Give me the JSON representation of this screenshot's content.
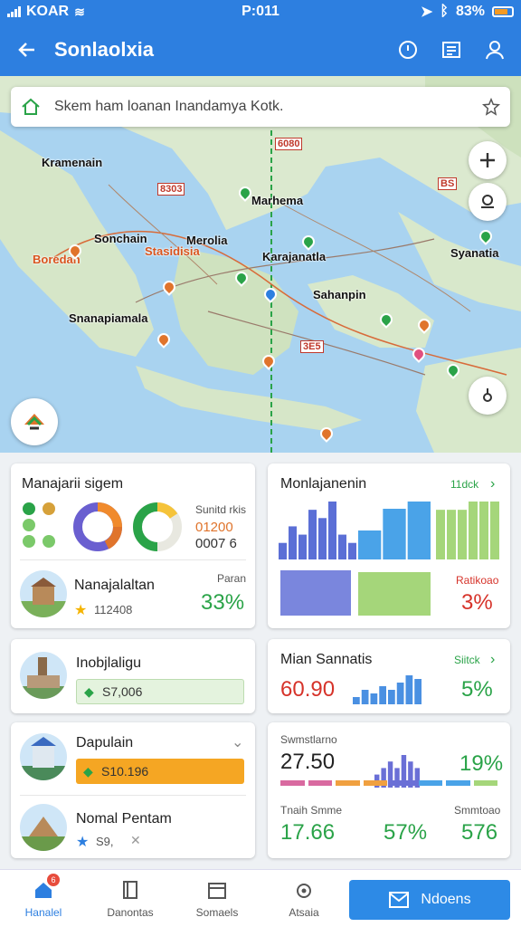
{
  "status_bar": {
    "carrier": "KOAR",
    "time": "P:011",
    "battery": "83%"
  },
  "app_bar": {
    "title": "Sonlaolxia"
  },
  "search": {
    "text": "Skem ham loanan Inandamya Kotk."
  },
  "map_labels": {
    "kramenain": "Kramenain",
    "marhema": "Marhema",
    "sonchain": "Sonchain",
    "merolia": "Merolia",
    "karajanatla": "Karajanatla",
    "boredan": "Boredan",
    "stasidisia": "Stasidisia",
    "syanatia": "Syanatia",
    "sahanpin": "Sahanpin",
    "snanapiamala": "Snanapiamala",
    "badge_a": "6080",
    "badge_b": "8303",
    "badge_c": "3E5",
    "badge_d": "BS"
  },
  "card1": {
    "title": "Manajarii sigem",
    "right_label": "Sunitd rkis",
    "num_a": "01200",
    "num_b": "0007 6"
  },
  "card2": {
    "title": "Monlajanenin",
    "link": "11dck",
    "footer_label": "Ratikoao",
    "footer_value": "3%"
  },
  "card3": {
    "title": "Nanajalaltan",
    "rating": "112408",
    "label": "Paran",
    "value": "33%"
  },
  "card4": {
    "title": "Inobjlaligu",
    "pill": "S7,006"
  },
  "card5": {
    "title": "Mian Sannatis",
    "link": "Siitck",
    "value": "60.90",
    "percent": "5%"
  },
  "card6": {
    "title": "Dapulain",
    "pill": "S10.196"
  },
  "card7": {
    "title": "Nomal Pentam",
    "rating": "S9,"
  },
  "card8": {
    "title": "Swmstlarno",
    "value": "27.50",
    "percent": "19%",
    "label_a": "Tnaih Smme",
    "label_b": "Smmtoao",
    "value_a": "17.66",
    "value_b": "57%",
    "value_c": "576"
  },
  "bottom_nav": {
    "items": [
      {
        "label": "Hanalel",
        "badge": "6"
      },
      {
        "label": "Danontas"
      },
      {
        "label": "Somaels"
      },
      {
        "label": "Atsaia"
      }
    ],
    "cta": "Ndoens"
  },
  "colors": {
    "primary": "#2d7fe0",
    "green": "#2aa348",
    "red": "#d6332a",
    "orange": "#f5a623"
  },
  "chart_data": [
    {
      "type": "bar",
      "values": [
        2,
        4,
        3,
        6,
        5,
        7,
        3,
        2
      ],
      "series_color": "#5b6fd6"
    },
    {
      "type": "bar",
      "values": [
        4,
        7,
        8
      ],
      "series_color": "#4aa3e8"
    },
    {
      "type": "bar",
      "values": [
        6,
        6,
        6,
        7,
        7,
        7
      ],
      "series_color": "#a5d67a"
    },
    {
      "type": "bar",
      "values": [
        1,
        2,
        1.5,
        2.5,
        2,
        3,
        4,
        3.5
      ],
      "series_color": "#4a90e2"
    },
    {
      "type": "bar",
      "values": [
        2,
        3,
        4,
        3,
        5,
        4,
        3
      ],
      "series_color": "#6a6fd6"
    }
  ]
}
